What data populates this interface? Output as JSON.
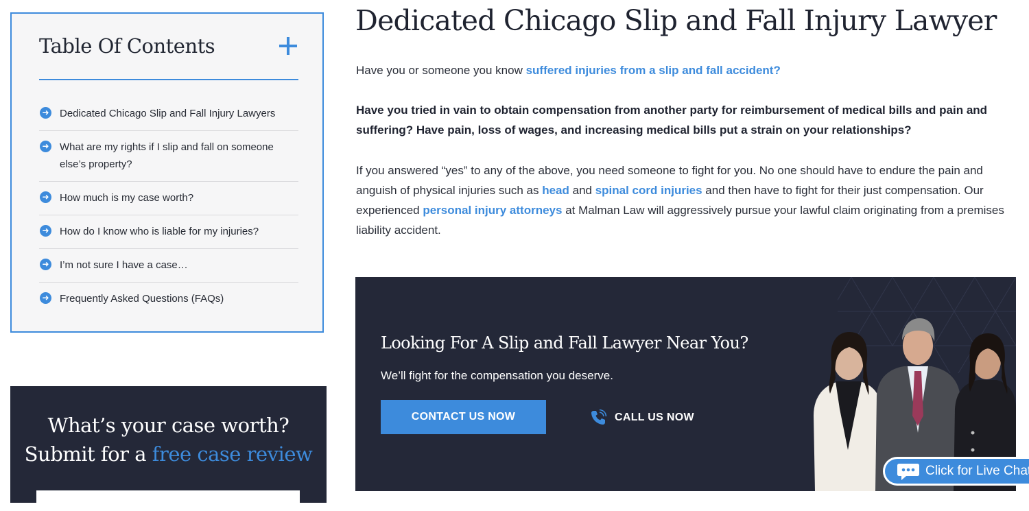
{
  "toc": {
    "title": "Table Of Contents",
    "items": [
      {
        "label": "Dedicated Chicago Slip and Fall Injury Lawyers"
      },
      {
        "label": "What are my rights if I slip and fall on someone else’s property?"
      },
      {
        "label": "How much is my case worth?"
      },
      {
        "label": "How do I know who is liable for my injuries?"
      },
      {
        "label": "I’m not sure I have a case…"
      },
      {
        "label": "Frequently Asked Questions (FAQs)"
      }
    ]
  },
  "case_review": {
    "line1": "What’s your case worth?",
    "line2_prefix": "Submit for a ",
    "line2_highlight": "free case review"
  },
  "main": {
    "heading": "Dedicated Chicago Slip and Fall Injury Lawyer",
    "p1_text": "Have you or someone you know ",
    "p1_link": "suffered injuries from a slip and fall accident?",
    "p2": "Have you tried in vain to obtain compensation from another party for reimbursement of medical bills and pain and suffering? Have pain, loss of wages, and increasing medical bills put a strain on your relationships?",
    "p3_a": "If you answered “yes” to any of the above, you need someone to fight for you. No one should have to endure the pain and anguish of physical injuries such as ",
    "p3_link1": "head",
    "p3_b": " and ",
    "p3_link2": "spinal cord injuries",
    "p3_c": " and then have to fight for their just compensation. Our experienced ",
    "p3_link3": "personal injury attorneys",
    "p3_d": " at Malman Law will aggressively pursue your lawful claim originating from a premises liability accident."
  },
  "cta": {
    "title": "Looking For A Slip and Fall Lawyer Near You?",
    "subtitle": "We’ll fight for the compensation you deserve.",
    "contact_label": "CONTACT US NOW",
    "call_label": "CALL US NOW"
  },
  "chat": {
    "label": "Click for Live Chat"
  },
  "colors": {
    "accent": "#3d8bdc",
    "navy": "#242838"
  },
  "icons": {
    "toc_expand": "plus-icon",
    "toc_bullet": "arrow-right-circle-icon",
    "call": "phone-icon",
    "chat": "chat-bubble-icon"
  }
}
